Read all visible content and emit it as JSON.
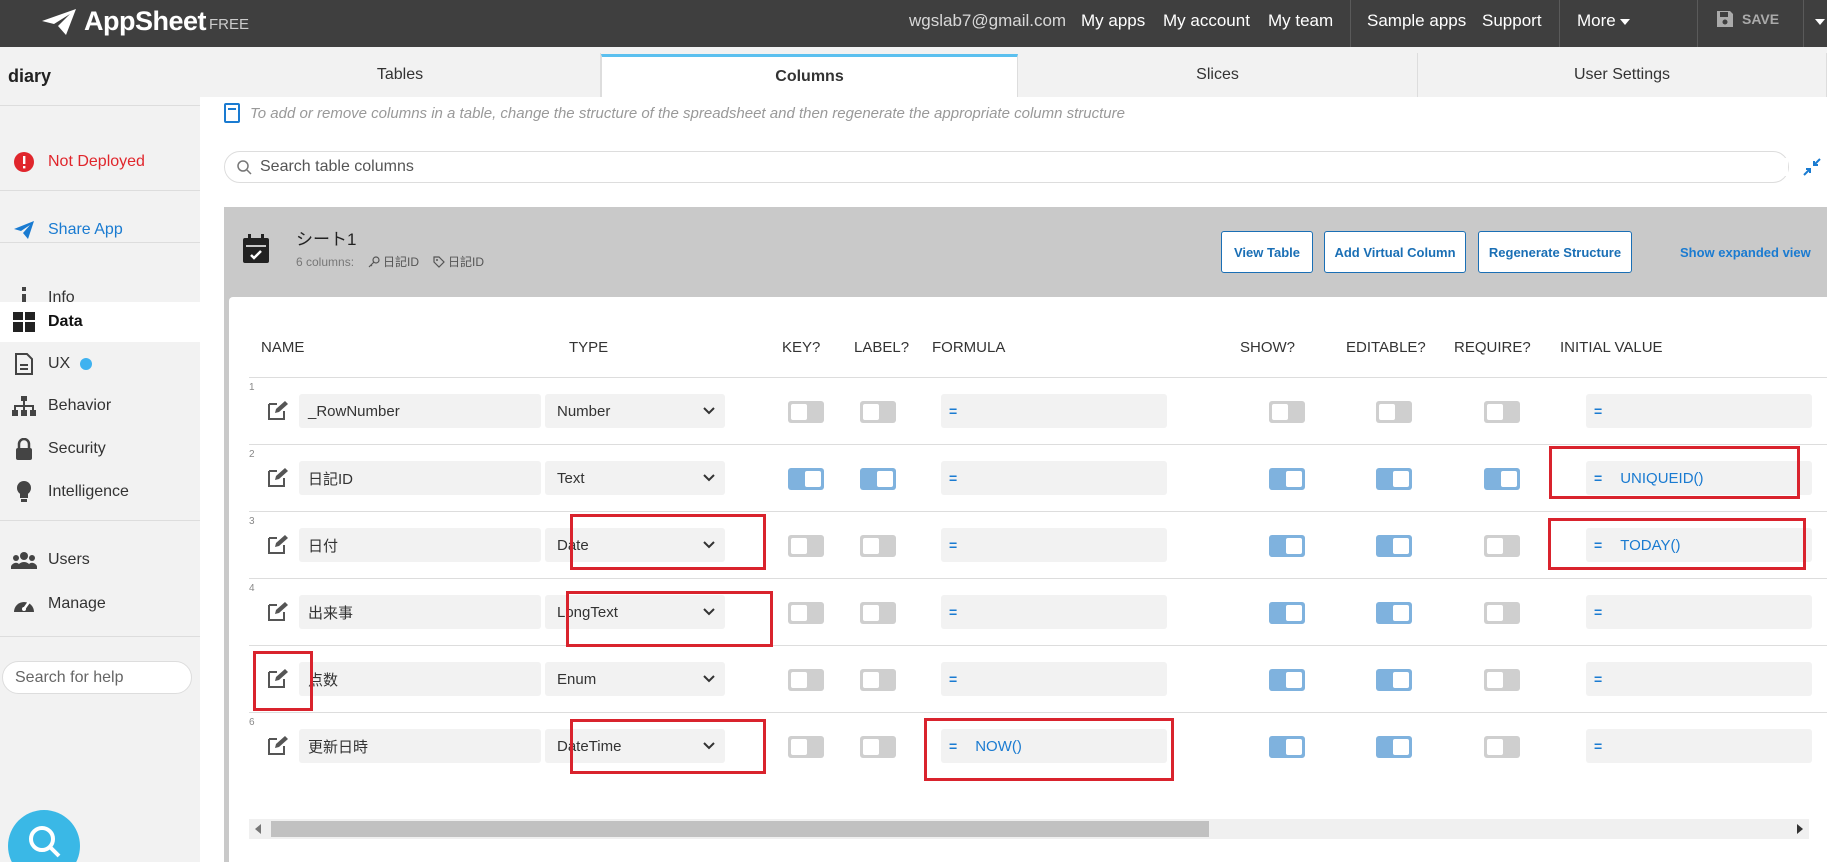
{
  "topbar": {
    "logo": "AppSheet",
    "plan": "FREE",
    "email": "wgslab7@gmail.com",
    "links": [
      "My apps",
      "My account",
      "My team",
      "Sample apps",
      "Support",
      "More"
    ],
    "save_label": "SAVE"
  },
  "sidebar": {
    "app_name": "diary",
    "status": "Not Deployed",
    "share": "Share App",
    "items": [
      "Info",
      "Data",
      "UX",
      "Behavior",
      "Security",
      "Intelligence"
    ],
    "items2": [
      "Users",
      "Manage"
    ],
    "active": "Data",
    "help_placeholder": "Search for help"
  },
  "tabs": [
    "Tables",
    "Columns",
    "Slices",
    "User Settings"
  ],
  "active_tab": "Columns",
  "hint": "To add or remove columns in a table, change the structure of the spreadsheet and then regenerate the appropriate column structure",
  "search_placeholder": "Search table columns",
  "table": {
    "name": "シート1",
    "column_count": "6 columns:",
    "key_label": "日記ID",
    "label_label": "日記ID",
    "buttons": [
      "View Table",
      "Add Virtual Column",
      "Regenerate Structure"
    ],
    "show_expanded": "Show expanded view"
  },
  "headers": [
    "NAME",
    "TYPE",
    "KEY?",
    "LABEL?",
    "FORMULA",
    "SHOW?",
    "EDITABLE?",
    "REQUIRE?",
    "INITIAL VALUE"
  ],
  "rows": [
    {
      "num": "1",
      "name": "_RowNumber",
      "type": "Number",
      "key": false,
      "label": false,
      "formula": "",
      "show": false,
      "editable": false,
      "require": false,
      "initial": ""
    },
    {
      "num": "2",
      "name": "日記ID",
      "type": "Text",
      "key": true,
      "label": true,
      "formula": "",
      "show": true,
      "editable": true,
      "require": true,
      "initial": "UNIQUEID()"
    },
    {
      "num": "3",
      "name": "日付",
      "type": "Date",
      "key": false,
      "label": false,
      "formula": "",
      "show": true,
      "editable": true,
      "require": false,
      "initial": "TODAY()"
    },
    {
      "num": "4",
      "name": "出来事",
      "type": "LongText",
      "key": false,
      "label": false,
      "formula": "",
      "show": true,
      "editable": true,
      "require": false,
      "initial": ""
    },
    {
      "num": "",
      "name": "点数",
      "type": "Enum",
      "key": false,
      "label": false,
      "formula": "",
      "show": true,
      "editable": true,
      "require": false,
      "initial": ""
    },
    {
      "num": "6",
      "name": "更新日時",
      "type": "DateTime",
      "key": false,
      "label": false,
      "formula": "NOW()",
      "show": true,
      "editable": true,
      "require": false,
      "initial": ""
    }
  ],
  "colors": {
    "accent": "#1a7bd1",
    "topbar": "#3f3f3f",
    "highlight": "#d9232d",
    "toggle_on": "#7fb2de",
    "alert": "#e0262c"
  }
}
